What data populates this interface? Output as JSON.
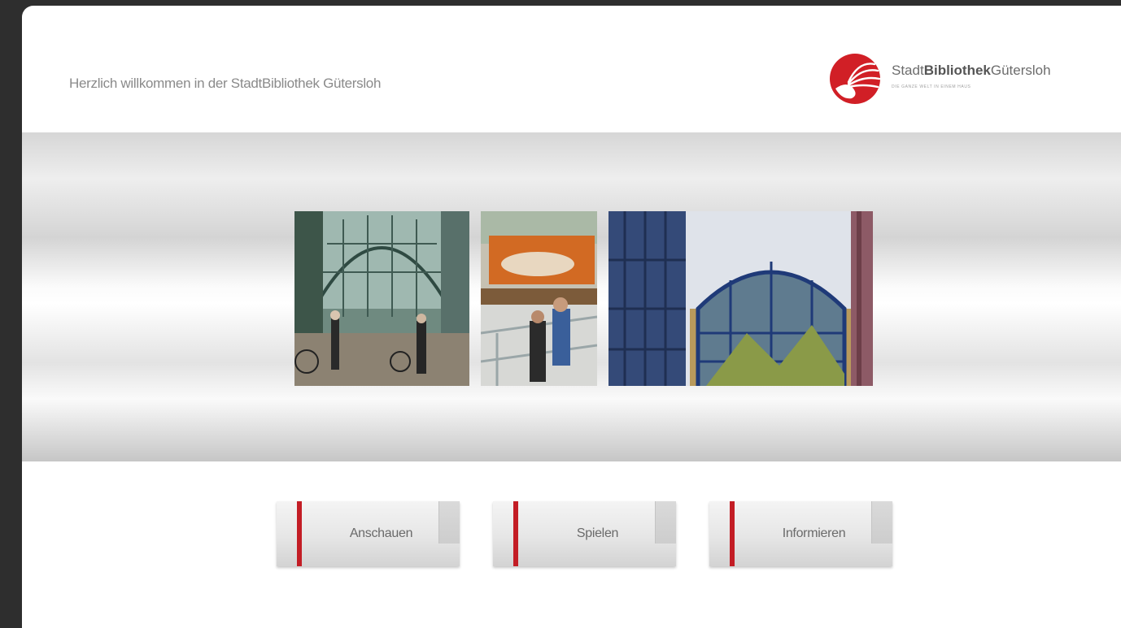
{
  "welcome_text": "Herzlich willkommen in der StadtBibliothek Gütersloh",
  "logo": {
    "name_light_1": "Stadt",
    "name_bold": "Bibliothek",
    "name_light_2": "Gütersloh",
    "tagline": "DIE GANZE WELT IN EINEM HAUS",
    "brand_color": "#d11f26"
  },
  "photos": [
    {
      "subject": "glass-arcade-with-bicycles"
    },
    {
      "subject": "reading-area-and-stairs"
    },
    {
      "subject": "blue-glass-facade"
    }
  ],
  "nav": {
    "buttons": [
      {
        "label": "Anschauen"
      },
      {
        "label": "Spielen"
      },
      {
        "label": "Informieren"
      }
    ],
    "accent_color": "#c31d25"
  }
}
